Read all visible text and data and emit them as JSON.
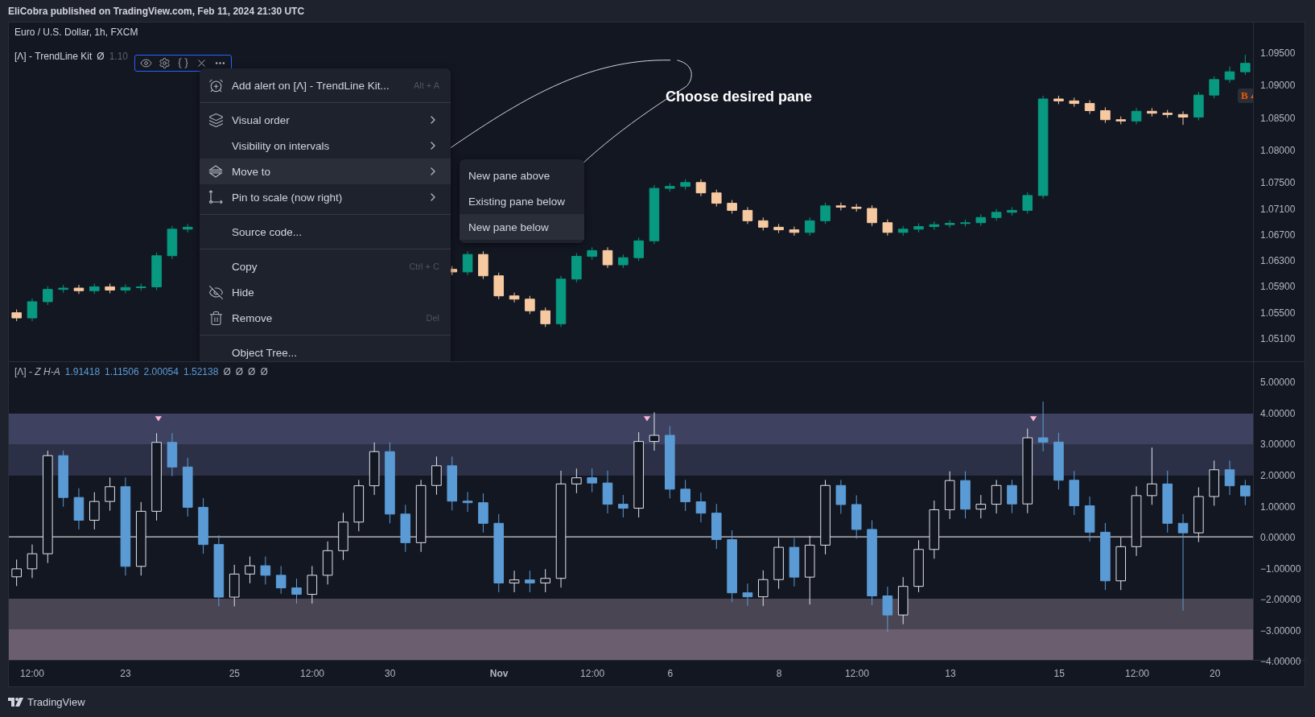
{
  "header": {
    "text": "EliCobra published on TradingView.com, Feb 11, 2024 21:30 UTC"
  },
  "main_pane": {
    "symbol": "Euro / U.S. Dollar, 1h, FXCM",
    "indicator": {
      "name": "[Λ] - TrendLine Kit",
      "values": [
        "Ø",
        "1.10"
      ]
    },
    "badge": "B",
    "chart_data": {
      "type": "candlestick",
      "ylim": [
        1.0475,
        1.0998
      ],
      "categories": [
        null,
        null,
        null,
        null,
        null,
        null,
        null,
        null,
        null,
        null,
        null,
        null,
        null,
        null,
        null,
        null,
        null,
        null,
        null,
        null,
        null,
        null,
        null,
        null,
        null,
        null,
        null,
        null,
        null,
        null,
        null,
        null,
        null,
        null,
        null,
        null,
        null,
        null,
        null,
        null,
        null,
        null,
        null,
        null,
        null,
        null,
        null,
        null,
        null,
        null,
        null,
        null,
        null,
        null,
        null,
        null,
        null,
        null,
        null,
        null,
        null,
        null,
        null,
        null,
        null,
        null,
        null,
        null,
        null,
        null,
        null,
        null,
        null,
        null,
        null,
        null,
        null,
        null,
        null,
        null
      ],
      "yticks": [
        {
          "value": 1.095,
          "label": "1.09500"
        },
        {
          "value": 1.09,
          "label": "1.09000"
        },
        {
          "value": 1.085,
          "label": "1.08500"
        },
        {
          "value": 1.08,
          "label": "1.08000"
        },
        {
          "value": 1.075,
          "label": "1.07500"
        },
        {
          "value": 1.071,
          "label": "1.07100"
        },
        {
          "value": 1.067,
          "label": "1.06700"
        },
        {
          "value": 1.063,
          "label": "1.06300"
        },
        {
          "value": 1.059,
          "label": "1.05900"
        },
        {
          "value": 1.055,
          "label": "1.05500"
        },
        {
          "value": 1.051,
          "label": "1.05100"
        }
      ],
      "ohlc": [
        [
          1.055,
          1.0555,
          1.0537,
          1.0542
        ],
        [
          1.0542,
          1.0572,
          1.0537,
          1.0567
        ],
        [
          1.0567,
          1.0591,
          1.0562,
          1.0586
        ],
        [
          1.0586,
          1.0593,
          1.0581,
          1.0588
        ],
        [
          1.0588,
          1.0593,
          1.0579,
          1.0584
        ],
        [
          1.0584,
          1.0595,
          1.0579,
          1.059
        ],
        [
          1.059,
          1.0595,
          1.058,
          1.0585
        ],
        [
          1.0585,
          1.0594,
          1.058,
          1.0589
        ],
        [
          1.0589,
          1.0595,
          1.0584,
          1.059
        ],
        [
          1.059,
          1.0643,
          1.0585,
          1.0638
        ],
        [
          1.0638,
          1.0684,
          1.0633,
          1.0679
        ],
        [
          1.0679,
          1.0687,
          1.0674,
          1.0682
        ],
        null,
        null,
        null,
        null,
        null,
        null,
        null,
        null,
        null,
        null,
        null,
        null,
        null,
        null,
        null,
        null,
        [
          1.0617,
          1.0622,
          1.0608,
          1.0613
        ],
        [
          1.0613,
          1.0645,
          1.0608,
          1.064
        ],
        [
          1.064,
          1.0645,
          1.0602,
          1.0607
        ],
        [
          1.0607,
          1.0612,
          1.0571,
          1.0576
        ],
        [
          1.0576,
          1.0581,
          1.0566,
          1.0571
        ],
        [
          1.0571,
          1.0576,
          1.0548,
          1.0553
        ],
        [
          1.0553,
          1.0558,
          1.0528,
          1.0533
        ],
        [
          1.0533,
          1.0607,
          1.0528,
          1.0602
        ],
        [
          1.0602,
          1.0642,
          1.0597,
          1.0637
        ],
        [
          1.0637,
          1.0651,
          1.0632,
          1.0646
        ],
        [
          1.0646,
          1.0651,
          1.0619,
          1.0624
        ],
        [
          1.0624,
          1.064,
          1.0619,
          1.0635
        ],
        [
          1.0635,
          1.0666,
          1.063,
          1.0661
        ],
        [
          1.0661,
          1.0747,
          1.0656,
          1.0742
        ],
        [
          1.0742,
          1.075,
          1.0737,
          1.0745
        ],
        [
          1.0745,
          1.0756,
          1.074,
          1.0751
        ],
        [
          1.0751,
          1.0756,
          1.073,
          1.0735
        ],
        [
          1.0735,
          1.074,
          1.0714,
          1.0719
        ],
        [
          1.0719,
          1.0724,
          1.0703,
          1.0708
        ],
        [
          1.0708,
          1.0713,
          1.0687,
          1.0692
        ],
        [
          1.0692,
          1.0697,
          1.0677,
          1.0682
        ],
        [
          1.0682,
          1.0687,
          1.0673,
          1.0678
        ],
        [
          1.0678,
          1.0683,
          1.0669,
          1.0674
        ],
        [
          1.0674,
          1.0697,
          1.0669,
          1.0692
        ],
        [
          1.0692,
          1.072,
          1.0687,
          1.0715
        ],
        [
          1.0715,
          1.072,
          1.0708,
          1.0713
        ],
        [
          1.0713,
          1.0718,
          1.0706,
          1.0711
        ],
        [
          1.0711,
          1.0716,
          1.0684,
          1.0689
        ],
        [
          1.0689,
          1.0694,
          1.0669,
          1.0674
        ],
        [
          1.0674,
          1.0684,
          1.0669,
          1.0679
        ],
        [
          1.0679,
          1.0688,
          1.0674,
          1.0683
        ],
        [
          1.0683,
          1.0691,
          1.0678,
          1.0686
        ],
        [
          1.0686,
          1.0693,
          1.0681,
          1.0688
        ],
        [
          1.0688,
          1.0694,
          1.0683,
          1.0689
        ],
        [
          1.0689,
          1.0702,
          1.0684,
          1.0697
        ],
        [
          1.0697,
          1.071,
          1.0692,
          1.0705
        ],
        [
          1.0705,
          1.0713,
          1.07,
          1.0708
        ],
        [
          1.0708,
          1.0736,
          1.0703,
          1.0731
        ],
        [
          1.0731,
          1.0885,
          1.0726,
          1.088
        ],
        [
          1.088,
          1.0885,
          1.0872,
          1.0877
        ],
        [
          1.0877,
          1.0882,
          1.0868,
          1.0873
        ],
        [
          1.0873,
          1.0878,
          1.0857,
          1.0862
        ],
        [
          1.0862,
          1.0867,
          1.0843,
          1.0848
        ],
        [
          1.0848,
          1.0853,
          1.0841,
          1.0846
        ],
        [
          1.0846,
          1.0866,
          1.0841,
          1.0861
        ],
        [
          1.0861,
          1.0866,
          1.0853,
          1.0858
        ],
        [
          1.0858,
          1.0863,
          1.0851,
          1.0856
        ],
        [
          1.0856,
          1.0861,
          1.084,
          1.0852
        ],
        [
          1.0852,
          1.0891,
          1.0847,
          1.0886
        ],
        [
          1.0886,
          1.0915,
          1.0881,
          1.091
        ],
        [
          1.091,
          1.093,
          1.0905,
          1.0922
        ],
        [
          1.0922,
          1.0948,
          1.0917,
          1.0935
        ]
      ]
    }
  },
  "context_menu": {
    "groups": [
      [
        {
          "label": "Add alert on [Λ] - TrendLine Kit...",
          "shortcut": "Alt + A",
          "submenu": false,
          "selected": false
        }
      ],
      [
        {
          "label": "Visual order",
          "submenu": true,
          "selected": false
        },
        {
          "label": "Visibility on intervals",
          "submenu": true,
          "selected": false
        },
        {
          "label": "Move to",
          "submenu": true,
          "selected": true
        },
        {
          "label": "Pin to scale (now right)",
          "submenu": true,
          "selected": false
        }
      ],
      [
        {
          "label": "Source code...",
          "submenu": false,
          "selected": false
        }
      ],
      [
        {
          "label": "Copy",
          "shortcut": "Ctrl + C",
          "submenu": false,
          "selected": false
        },
        {
          "label": "Hide",
          "submenu": false,
          "selected": false
        },
        {
          "label": "Remove",
          "shortcut": "Del",
          "submenu": false,
          "selected": false
        }
      ],
      [
        {
          "label": "Object Tree...",
          "submenu": false,
          "selected": false
        }
      ]
    ]
  },
  "submenu": {
    "items": [
      {
        "label": "New pane above",
        "selected": false
      },
      {
        "label": "Existing pane below",
        "selected": false
      },
      {
        "label": "New pane below",
        "selected": true
      }
    ]
  },
  "annotation": {
    "text": "Choose desired pane"
  },
  "lower_pane": {
    "indicator": {
      "name": "[Λ] - *Z H-A*",
      "values": [
        "1.91418",
        "1.11506",
        "2.00054",
        "1.52138"
      ],
      "empty_values": [
        "Ø",
        "Ø",
        "Ø",
        "Ø"
      ]
    },
    "chart_data": {
      "type": "candlestick",
      "ylim": [
        -4.0,
        5.68
      ],
      "categories": [
        null,
        "12:00",
        null,
        null,
        null,
        null,
        null,
        "23",
        null,
        null,
        null,
        null,
        null,
        null,
        "25",
        null,
        null,
        null,
        null,
        "12:00",
        null,
        null,
        null,
        null,
        "30",
        null,
        null,
        null,
        null,
        null,
        null,
        "Nov",
        null,
        null,
        null,
        null,
        null,
        "12:00",
        null,
        null,
        null,
        null,
        "6",
        null,
        null,
        null,
        null,
        null,
        null,
        "8",
        null,
        null,
        null,
        null,
        "12:00",
        null,
        null,
        null,
        null,
        null,
        "13",
        null,
        null,
        null,
        null,
        null,
        null,
        "15",
        null,
        null,
        null,
        null,
        "12:00",
        null,
        null,
        null,
        null,
        "20",
        null,
        null
      ],
      "yticks": [
        {
          "value": 5,
          "label": "5.00000"
        },
        {
          "value": 4,
          "label": "4.00000"
        },
        {
          "value": 3,
          "label": "3.00000"
        },
        {
          "value": 2,
          "label": "2.00000"
        },
        {
          "value": 1,
          "label": "1.00000"
        },
        {
          "value": 0,
          "label": "0.00000"
        },
        {
          "value": -1,
          "label": "−1.00000"
        },
        {
          "value": -2,
          "label": "−2.00000"
        },
        {
          "value": -3,
          "label": "−3.00000"
        },
        {
          "value": -4,
          "label": "−4.00000"
        }
      ],
      "ohlc": [
        [
          -1.3,
          -0.74,
          -1.6,
          -1.04
        ],
        [
          -1.04,
          -0.25,
          -1.34,
          -0.55
        ],
        [
          -0.55,
          2.8,
          -0.85,
          2.64
        ],
        [
          2.64,
          2.8,
          0.98,
          1.28
        ],
        [
          1.28,
          1.58,
          0.24,
          0.54
        ],
        [
          0.54,
          1.45,
          0.24,
          1.15
        ],
        [
          1.15,
          1.93,
          0.85,
          1.63
        ],
        [
          1.63,
          1.93,
          -1.26,
          -0.96
        ],
        [
          -0.96,
          1.13,
          -1.26,
          0.83
        ],
        [
          0.83,
          3.37,
          0.53,
          3.07
        ],
        [
          3.07,
          3.37,
          1.97,
          2.27
        ],
        [
          2.27,
          2.57,
          0.66,
          0.96
        ],
        [
          0.96,
          1.26,
          -0.55,
          -0.25
        ],
        [
          -0.25,
          0.05,
          -2.26,
          -1.96
        ],
        [
          -1.96,
          -0.91,
          -2.26,
          -1.21
        ],
        [
          -1.21,
          -0.64,
          -1.51,
          -0.94
        ],
        [
          -0.94,
          -0.64,
          -1.55,
          -1.25
        ],
        [
          -1.25,
          -0.95,
          -1.85,
          -1.66
        ],
        [
          -1.66,
          -1.36,
          -2.17,
          -1.87
        ],
        [
          -1.87,
          -0.95,
          -2.17,
          -1.25
        ],
        [
          -1.25,
          -0.15,
          -1.55,
          -0.45
        ],
        [
          -0.45,
          0.78,
          -0.75,
          0.48
        ],
        [
          0.48,
          1.85,
          0.18,
          1.66
        ],
        [
          1.66,
          3.07,
          1.36,
          2.77
        ],
        [
          2.77,
          3.07,
          0.44,
          0.74
        ],
        [
          0.74,
          1.04,
          -0.49,
          -0.19
        ],
        [
          -0.19,
          1.85,
          -0.49,
          1.67
        ],
        [
          1.67,
          2.61,
          1.37,
          2.31
        ],
        [
          2.31,
          2.61,
          0.86,
          1.16
        ],
        [
          1.16,
          1.46,
          0.81,
          1.11
        ],
        [
          1.11,
          1.41,
          0.14,
          0.44
        ],
        [
          0.44,
          0.74,
          -1.8,
          -1.5
        ],
        [
          -1.5,
          -1.1,
          -1.8,
          -1.4
        ],
        [
          -1.4,
          -1.1,
          -1.8,
          -1.5
        ],
        [
          -1.5,
          -1.05,
          -1.8,
          -1.35
        ],
        [
          -1.35,
          2.15,
          -1.65,
          1.72
        ],
        [
          1.72,
          2.22,
          1.42,
          1.92
        ],
        [
          1.92,
          2.22,
          1.45,
          1.75
        ],
        [
          1.75,
          2.15,
          0.76,
          1.06
        ],
        [
          1.06,
          1.36,
          0.63,
          0.93
        ],
        [
          0.93,
          3.4,
          0.63,
          3.1
        ],
        [
          3.1,
          4.05,
          2.8,
          3.3
        ],
        [
          3.3,
          3.6,
          1.25,
          1.55
        ],
        [
          1.55,
          1.85,
          0.84,
          1.14
        ],
        [
          1.14,
          1.44,
          0.47,
          0.77
        ],
        [
          0.77,
          1.07,
          -0.39,
          -0.09
        ],
        [
          -0.09,
          0.21,
          -2.12,
          -1.82
        ],
        [
          -1.82,
          -1.52,
          -2.25,
          -1.95
        ],
        [
          -1.95,
          -1.09,
          -2.25,
          -1.39
        ],
        [
          -1.39,
          -0.04,
          -1.69,
          -0.34
        ],
        [
          -0.34,
          -0.04,
          -1.61,
          -1.31
        ],
        [
          -1.31,
          0.03,
          -2.2,
          -0.27
        ],
        [
          -0.27,
          1.85,
          -0.57,
          1.67
        ],
        [
          1.67,
          1.85,
          0.75,
          1.05
        ],
        [
          1.05,
          1.35,
          -0.06,
          0.24
        ],
        [
          0.24,
          0.54,
          -2.22,
          -1.92
        ],
        [
          -1.92,
          -1.62,
          -3.1,
          -2.54
        ],
        [
          -2.54,
          -1.31,
          -2.84,
          -1.61
        ],
        [
          -1.61,
          -0.11,
          -1.8,
          -0.41
        ],
        [
          -0.41,
          1.18,
          -0.71,
          0.88
        ],
        [
          0.88,
          2.13,
          0.58,
          1.83
        ],
        [
          1.83,
          2.13,
          0.6,
          0.9
        ],
        [
          0.9,
          1.36,
          0.6,
          1.06
        ],
        [
          1.06,
          1.85,
          0.76,
          1.67
        ],
        [
          1.67,
          1.85,
          0.77,
          1.07
        ],
        [
          1.07,
          3.52,
          0.77,
          3.22
        ],
        [
          3.22,
          4.4,
          2.78,
          3.08
        ],
        [
          3.08,
          3.38,
          1.54,
          1.84
        ],
        [
          1.84,
          2.14,
          0.71,
          1.01
        ],
        [
          1.01,
          1.31,
          -0.15,
          0.15
        ],
        [
          0.15,
          0.45,
          -1.73,
          -1.43
        ],
        [
          -1.43,
          -0.02,
          -1.73,
          -0.32
        ],
        [
          -0.32,
          1.64,
          -0.62,
          1.34
        ],
        [
          1.34,
          2.9,
          1.04,
          1.72
        ],
        [
          1.72,
          2.15,
          0.14,
          0.44
        ],
        [
          0.44,
          0.74,
          -2.4,
          0.13
        ],
        [
          0.13,
          1.61,
          -0.17,
          1.31
        ],
        [
          1.31,
          2.48,
          1.01,
          2.18
        ],
        [
          2.18,
          2.48,
          1.36,
          1.66
        ],
        [
          1.66,
          1.85,
          1.03,
          1.33
        ]
      ]
    }
  },
  "time_axis": {
    "labels": [
      {
        "bold": false
      },
      {
        "bold": false
      },
      {
        "bold": false
      },
      {
        "bold": false
      },
      {
        "bold": false
      },
      {
        "bold": true
      },
      {
        "bold": false
      },
      {
        "bold": false
      },
      {
        "bold": false
      },
      {
        "bold": false
      },
      {
        "bold": false
      },
      {
        "bold": false
      },
      {
        "bold": false
      },
      {
        "bold": false
      }
    ]
  },
  "footer": {
    "brand": "TradingView"
  }
}
